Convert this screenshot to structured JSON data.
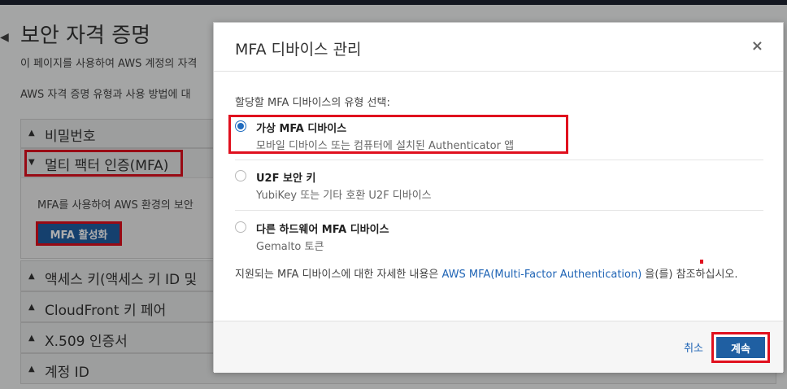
{
  "background_page": {
    "title": "보안 자격 증명",
    "description_1": "이 페이지를 사용하여 AWS 계정의 자격",
    "description_2": "AWS 자격 증명 유형과 사용 방법에 대",
    "sections": {
      "password": "비밀번호",
      "mfa": "멀티 팩터 인증(MFA)",
      "mfa_description": "MFA를 사용하여 AWS 환경의 보안",
      "mfa_button": "MFA 활성화",
      "access_keys": "액세스 키(액세스 키 ID 및",
      "cloudfront": "CloudFront 키 페어",
      "x509": "X.509 인증서",
      "account_id": "계정 ID"
    }
  },
  "modal": {
    "title": "MFA 디바이스 관리",
    "close_glyph": "×",
    "prompt": "할당할 MFA 디바이스의 유형 선택:",
    "options": [
      {
        "title": "가상 MFA 디바이스",
        "subtitle": "모바일 디바이스 또는 컴퓨터에 설치된 Authenticator 앱",
        "selected": true
      },
      {
        "title": "U2F 보안 키",
        "subtitle": "YubiKey 또는 기타 호환 U2F 디바이스",
        "selected": false
      },
      {
        "title": "다른 하드웨어 MFA 디바이스",
        "subtitle": "Gemalto 토큰",
        "selected": false
      }
    ],
    "info_prefix": "지원되는 MFA 디바이스에 대한 자세한 내용은 ",
    "info_link": "AWS MFA(Multi-Factor Authentication)",
    "info_suffix": " 을(를) 참조하십시오.",
    "cancel_label": "취소",
    "continue_label": "계속"
  },
  "colors": {
    "accent": "#1f5fa2",
    "link": "#1f64b5",
    "highlight": "#e0101e"
  }
}
